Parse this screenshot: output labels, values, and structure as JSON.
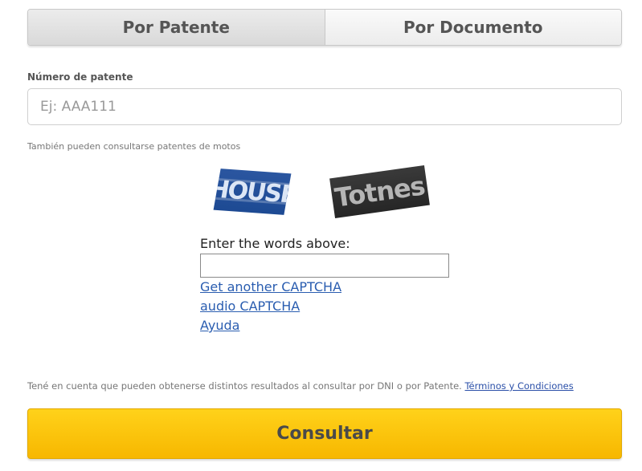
{
  "tabs": [
    {
      "label": "Por Patente",
      "active": true
    },
    {
      "label": "Por Documento",
      "active": false
    }
  ],
  "field": {
    "label": "Número de patente",
    "value": "",
    "placeholder": "Ej: AAA111",
    "hint": "También pueden consultarse patentes de motos"
  },
  "captcha": {
    "words": [
      "HOUSE",
      "Totnes"
    ],
    "prompt": "Enter the words above:",
    "input_value": "",
    "links": [
      "Get another CAPTCHA",
      "audio CAPTCHA",
      "Ayuda"
    ]
  },
  "note": {
    "text": "Tené en cuenta que pueden obtenerse distintos resultados al consultar por DNI o por Patente.",
    "link": "Términos y Condiciones"
  },
  "submit_label": "Consultar",
  "colors": {
    "accent": "#ffc400",
    "link": "#2a5db0"
  }
}
